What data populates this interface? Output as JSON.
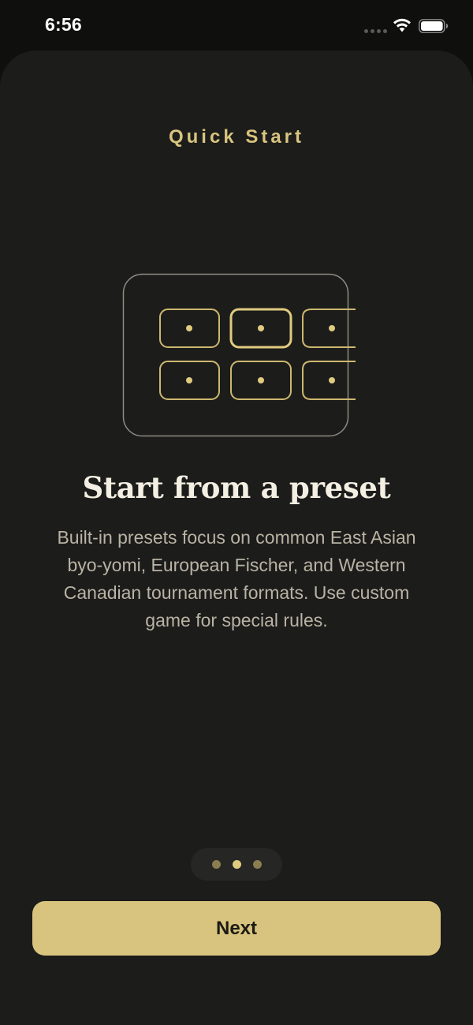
{
  "status_bar": {
    "time": "6:56",
    "icons": [
      "signal-dots-icon",
      "wifi-icon",
      "battery-icon"
    ]
  },
  "sheet": {
    "title": "Quick Start",
    "illustration_icon": "preset-grid-icon",
    "headline": "Start from a preset",
    "body": "Built-in presets focus on common East Asian byo-yomi, European Fischer, and Western Canadian tournament formats. Use custom game for special rules."
  },
  "pager": {
    "page_count": 3,
    "current_page": 2
  },
  "next_button": {
    "label": "Next"
  },
  "colors": {
    "background": "#0f0f0e",
    "sheet": "#1c1c1b",
    "accent": "#d8c47e",
    "accent_dim": "#8a7d4f",
    "text_primary": "#f4efe3",
    "text_secondary": "#b9b3a4"
  }
}
